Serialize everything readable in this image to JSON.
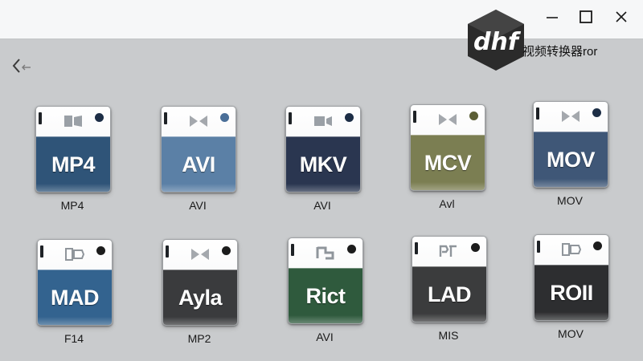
{
  "window": {
    "title": "视频转换器ror",
    "logo_text": "dhf",
    "controls": {
      "minimize": "minimize-icon",
      "maximize": "maximize-icon",
      "close": "close-icon"
    }
  },
  "nav": {
    "back_icon": "back-arrow-icon"
  },
  "colors": {
    "titlebar": "#f6f7f8",
    "background": "#c9cbcd",
    "logo": "#2b2b2b"
  },
  "formats": [
    {
      "icon_label": "MP4",
      "caption": "MP4",
      "band_color": "#2f5478",
      "dot_color": "#1d2e46",
      "glyph": "film-icon"
    },
    {
      "icon_label": "AVI",
      "caption": "AVI",
      "band_color": "#5b80a6",
      "dot_color": "#4a6f98",
      "glyph": "bowtie-icon"
    },
    {
      "icon_label": "MKV",
      "caption": "AVI",
      "band_color": "#2a3650",
      "dot_color": "#1d2e46",
      "glyph": "camera-icon"
    },
    {
      "icon_label": "MCV",
      "caption": "Avl",
      "band_color": "#7b7e52",
      "dot_color": "#5b5e35",
      "glyph": "bowtie-icon"
    },
    {
      "icon_label": "MOV",
      "caption": "MOV",
      "band_color": "#3f5777",
      "dot_color": "#1d2e46",
      "glyph": "bowtie-icon"
    },
    {
      "icon_label": "MAD",
      "caption": "F14",
      "band_color": "#33638f",
      "dot_color": "#1c1c1c",
      "glyph": "photo-icon"
    },
    {
      "icon_label": "Ayla",
      "caption": "MP2",
      "band_color": "#3a3b3d",
      "dot_color": "#1c1c1c",
      "glyph": "bowtie-icon"
    },
    {
      "icon_label": "Rict",
      "caption": "AVI",
      "band_color": "#2f5a3d",
      "dot_color": "#1c1c1c",
      "glyph": "flag-icon"
    },
    {
      "icon_label": "LAD",
      "caption": "MIS",
      "band_color": "#3b3c3d",
      "dot_color": "#1c1c1c",
      "glyph": "text-icon"
    },
    {
      "icon_label": "ROII",
      "caption": "MOV",
      "band_color": "#2d2e30",
      "dot_color": "#1c1c1c",
      "glyph": "photo-icon"
    }
  ]
}
